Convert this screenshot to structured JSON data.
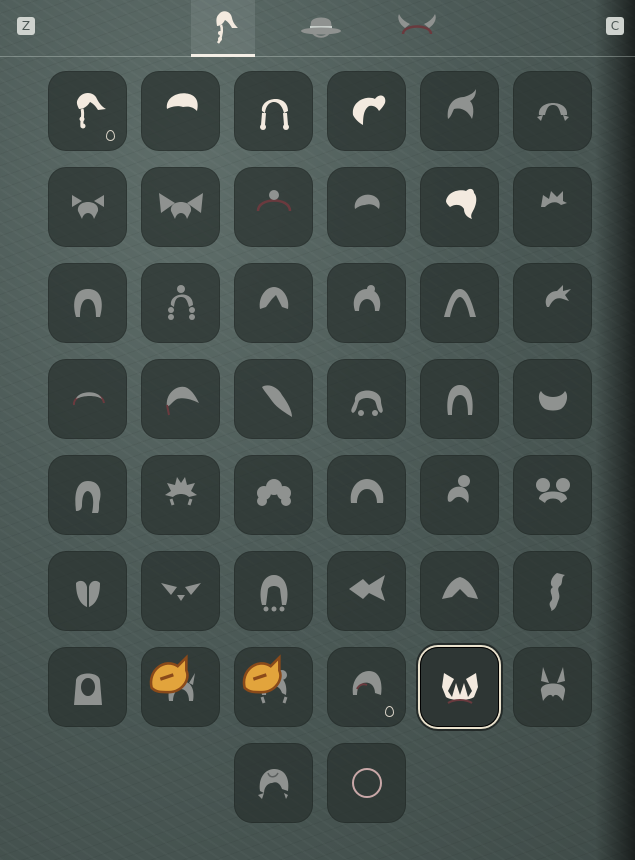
{
  "keys": {
    "left": "Z",
    "right": "C"
  },
  "tabs": [
    {
      "name": "hair-tab",
      "icon": "hair-icon",
      "active": true
    },
    {
      "name": "hat-tab",
      "icon": "hat-icon",
      "active": false
    },
    {
      "name": "horns-tab",
      "icon": "horns-icon",
      "active": false
    }
  ],
  "colors": {
    "owned": "#f3eadf",
    "locked": "#8f9290",
    "accent_ring": "#e9e1cc",
    "badge": "#e2a43c"
  },
  "hairstyles": [
    {
      "icon": "hair-ponytail-side-icon",
      "owned": true,
      "dye": true
    },
    {
      "icon": "hair-short-icon",
      "owned": true
    },
    {
      "icon": "hair-twin-braids-icon",
      "owned": true
    },
    {
      "icon": "hair-high-ponytail-icon",
      "owned": true
    },
    {
      "icon": "hair-side-swept-icon",
      "owned": false
    },
    {
      "icon": "hair-low-tails-icon",
      "owned": false
    },
    {
      "icon": "hair-bows-icon",
      "owned": false
    },
    {
      "icon": "hair-big-bows-icon",
      "owned": false
    },
    {
      "icon": "hair-bun-hoop-icon",
      "owned": false
    },
    {
      "icon": "hair-cap-short-icon",
      "owned": false
    },
    {
      "icon": "hair-swoop-icon",
      "owned": true
    },
    {
      "icon": "hair-spiky-icon",
      "owned": false
    },
    {
      "icon": "hair-long-icon",
      "owned": false
    },
    {
      "icon": "hair-braided-pigtails-icon",
      "owned": false
    },
    {
      "icon": "hair-bob-parted-icon",
      "owned": false
    },
    {
      "icon": "hair-bob-icon",
      "owned": false
    },
    {
      "icon": "hair-long-straight-icon",
      "owned": false
    },
    {
      "icon": "hair-wild-icon",
      "owned": false
    },
    {
      "icon": "hair-thin-arc-icon",
      "owned": false
    },
    {
      "icon": "hair-side-bang-icon",
      "owned": false
    },
    {
      "icon": "hair-single-lock-icon",
      "owned": false
    },
    {
      "icon": "hair-curly-icon",
      "owned": false
    },
    {
      "icon": "hair-straight-shoulder-icon",
      "owned": false
    },
    {
      "icon": "hair-beard-icon",
      "owned": false
    },
    {
      "icon": "hair-wavy-long-icon",
      "owned": false
    },
    {
      "icon": "hair-flame-icon",
      "owned": false
    },
    {
      "icon": "hair-fluffy-icon",
      "owned": false
    },
    {
      "icon": "hair-round-icon",
      "owned": false
    },
    {
      "icon": "hair-bun-top-icon",
      "owned": false
    },
    {
      "icon": "hair-double-buns-icon",
      "owned": false
    },
    {
      "icon": "hair-split-icon",
      "owned": false
    },
    {
      "icon": "hair-wings-icon",
      "owned": false
    },
    {
      "icon": "hair-long-tails-icon",
      "owned": false
    },
    {
      "icon": "hair-fish-icon",
      "owned": false
    },
    {
      "icon": "hair-hood-icon",
      "owned": false
    },
    {
      "icon": "hair-braid-icon",
      "owned": false
    },
    {
      "icon": "hair-hijab-icon",
      "owned": false
    },
    {
      "icon": "hair-cat-ears-icon",
      "owned": false,
      "badge": true
    },
    {
      "icon": "hair-bun-ribbon-icon",
      "owned": false,
      "badge": true
    },
    {
      "icon": "hair-helmet-icon",
      "owned": false,
      "dye": true
    },
    {
      "icon": "hair-feather-icon",
      "owned": true,
      "selected": true
    },
    {
      "icon": "hair-bunny-ears-icon",
      "owned": false
    },
    {
      "icon": "empty-spacer",
      "spacer": true
    },
    {
      "icon": "empty-spacer",
      "spacer": true
    },
    {
      "icon": "hair-messy-icon",
      "owned": false
    },
    {
      "icon": "hair-none-circle-icon",
      "owned": false
    }
  ]
}
